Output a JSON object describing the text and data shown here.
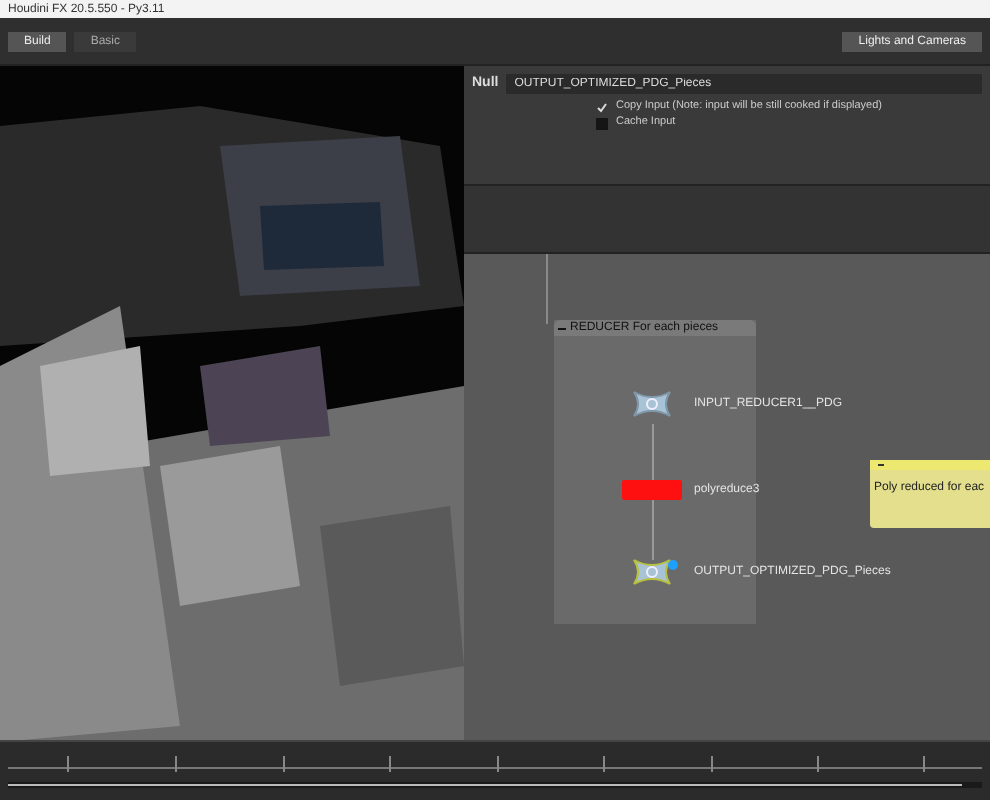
{
  "window": {
    "title": "Houdini FX 20.5.550 - Py3.11"
  },
  "desktop_tabs": [
    {
      "label": "Build",
      "selected": true
    },
    {
      "label": "Basic",
      "selected": false
    }
  ],
  "shelf_tabs": [
    {
      "label": "Lights and Cameras",
      "selected": true
    }
  ],
  "parameters": {
    "node_type": "Null",
    "node_name": "OUTPUT_OPTIMIZED_PDG_Pieces",
    "options": [
      {
        "label": "Copy Input (Note: input will be still cooked if displayed)",
        "checked": true
      },
      {
        "label": "Cache Input",
        "checked": false
      }
    ]
  },
  "network": {
    "group": {
      "title": "REDUCER For each pieces",
      "expanded": true
    },
    "nodes": [
      {
        "label": "INPUT_REDUCER1__PDG",
        "kind": "null",
        "bypassed": false,
        "display": false
      },
      {
        "label": "polyreduce3",
        "kind": "sop",
        "bypassed": true,
        "display": false
      },
      {
        "label": "OUTPUT_OPTIMIZED_PDG_Pieces",
        "kind": "null",
        "bypassed": false,
        "display": true
      }
    ],
    "sticky_note": {
      "text": "Poly reduced for eac"
    }
  },
  "timeline": {
    "level": 0.98
  }
}
